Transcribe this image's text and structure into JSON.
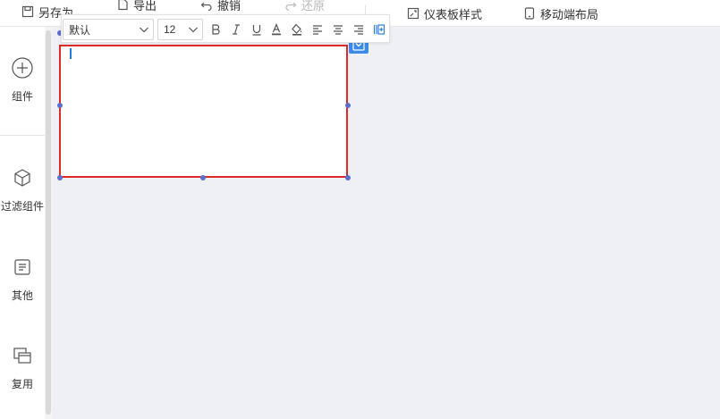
{
  "toolbar": {
    "save_as": "另存为",
    "export": "导出",
    "undo": "撤销",
    "redo": "还原",
    "dashboard_style": "仪表板样式",
    "mobile_layout": "移动端布局"
  },
  "sidebar": {
    "items": [
      {
        "label": "组件"
      },
      {
        "label": "过滤组件"
      },
      {
        "label": "其他"
      },
      {
        "label": "复用"
      }
    ]
  },
  "format_bar": {
    "font_family": "默认",
    "font_size": "12"
  },
  "colors": {
    "accent": "#3d8be8",
    "selection_border": "#e02a2a",
    "canvas_bg": "#eef0f5"
  }
}
